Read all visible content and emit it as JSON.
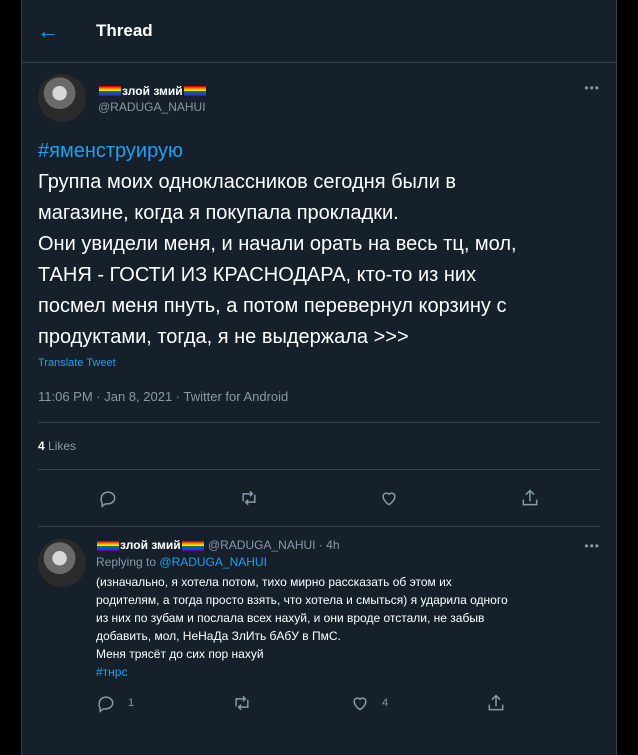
{
  "header": {
    "title": "Thread"
  },
  "main_tweet": {
    "display_name": "злой змий",
    "handle": "@RADUGA_NAHUI",
    "hashtag": "#яменструирую",
    "lines": [
      "Группа моих одноклассников сегодня были в",
      "магазине, когда я покупала прокладки.",
      "Они увидели меня, и начали орать на весь тц, мол,",
      "ТАНЯ - ГОСТИ ИЗ КРАСНОДАРА, кто-то из них",
      "посмел меня пнуть, а потом перевернул корзину с",
      "продуктами, тогда, я не выдержала >>>"
    ],
    "translate": "Translate Tweet",
    "meta": "11:06 PM · Jan 8, 2021 · Twitter for Android",
    "likes_count": "4",
    "likes_label": "Likes"
  },
  "reply": {
    "display_name": "злой змий",
    "handle_time": "@RADUGA_NAHUI · 4h",
    "replying_prefix": "Replying to",
    "replying_handle": "@RADUGA_NAHUI",
    "lines": [
      "(изначально, я хотела потом, тихо мирно рассказать об этом их",
      "родителям, а тогда просто взять, что хотела и смыться) я ударила одного",
      "из них по зубам и послала всех нахуй, и они вроде отстали, не забыв",
      "добавить, мол, НеНаДа ЗлИть бАбУ в ПмС.",
      "Меня трясёт до сих пор нахуй"
    ],
    "hashtag": "#тнрс",
    "reply_count": "1",
    "like_count": "4"
  },
  "icons": {
    "back": "arrow-left-icon",
    "more": "more-icon",
    "reply": "comment-icon",
    "retweet": "retweet-icon",
    "like": "heart-icon",
    "share": "share-icon"
  },
  "colors": {
    "background": "#15202b",
    "accent": "#1da1f2",
    "border": "#38444d",
    "muted": "#8899a6"
  }
}
